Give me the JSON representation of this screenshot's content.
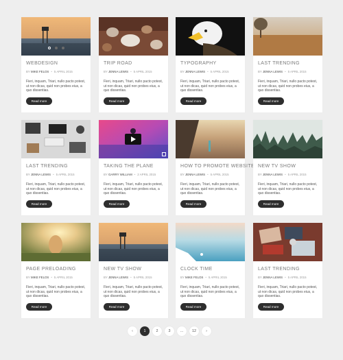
{
  "button_label": "Read more",
  "excerpt": "Fieri, inquam, Triari, nullo pacto potest, ut non dicas, quid non probes eius, a quo dissentias.",
  "by_prefix": "BY",
  "dot": "•",
  "cards": [
    {
      "title": "WEBDESIGN",
      "author": "MIKE FELOS",
      "date": "5 APRIL 2015",
      "thumb": "pier-sunset",
      "slider": true
    },
    {
      "title": "TRIP ROAD",
      "author": "JENNA LEWIS",
      "date": "5 APRIL 2015",
      "thumb": "cafe-table"
    },
    {
      "title": "TYPOGRAPHY",
      "author": "JENNA LEWIS",
      "date": "5 APRIL 2015",
      "thumb": "eagle"
    },
    {
      "title": "LAST TRENDING",
      "author": "JENNA LEWIS",
      "date": "5 APRIL 2015",
      "thumb": "grass-field"
    },
    {
      "title": "LAST TRENDING",
      "author": "JENNA LEWIS",
      "date": "5 APRIL 2015",
      "thumb": "desk"
    },
    {
      "title": "TAKING THE PLANE",
      "author": "GARRY WILLIAM",
      "date": "2 APRIL 2015",
      "thumb": "video",
      "video": true
    },
    {
      "title": "HOW TO PROMOTE WEBSITE?",
      "author": "JENNA LEWIS",
      "date": "5 APRIL 2015",
      "thumb": "beach"
    },
    {
      "title": "NEW TV SHOW",
      "author": "JENNA LEWIS",
      "date": "5 APRIL 2015",
      "thumb": "forest"
    },
    {
      "title": "PAGE PRELOADING",
      "author": "MIKE FELOS",
      "date": "5 APRIL 2015",
      "thumb": "girl-sunlight"
    },
    {
      "title": "NEW TV SHOW",
      "author": "JENNA LEWIS",
      "date": "5 APRIL 2015",
      "thumb": "pier-sunset"
    },
    {
      "title": "CLOCK TIME",
      "author": "MIKE FELOS",
      "date": "5 APRIL 2015",
      "thumb": "pool-sea"
    },
    {
      "title": "LAST TRENDING",
      "author": "JENNA LEWIS",
      "date": "5 APRIL 2015",
      "thumb": "paper-stack"
    }
  ],
  "pagination": {
    "prev": "‹",
    "pages": [
      "1",
      "2",
      "3",
      "...",
      "12"
    ],
    "next": "›",
    "active": "1"
  }
}
